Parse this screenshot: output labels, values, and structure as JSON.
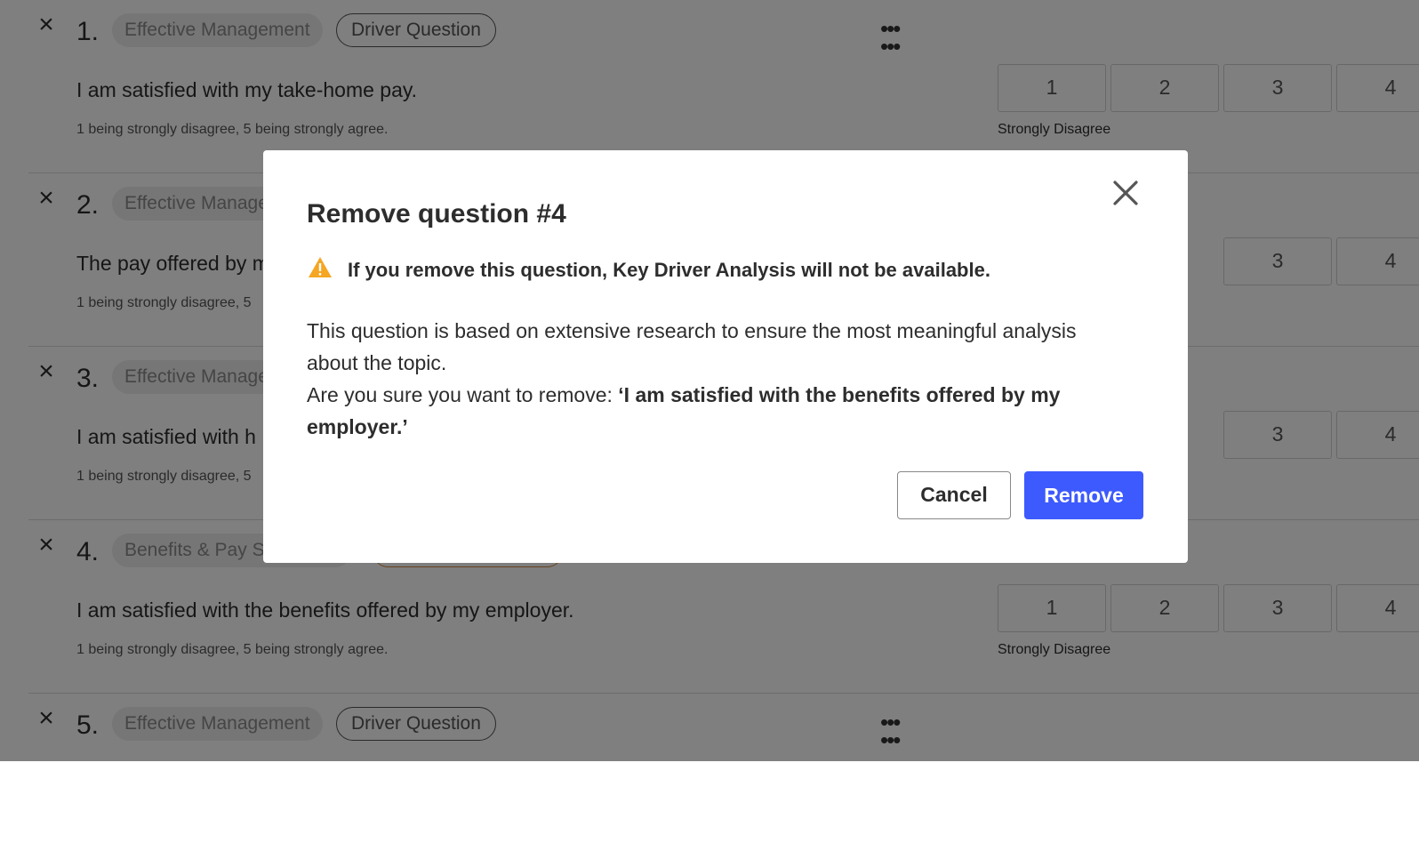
{
  "questions": [
    {
      "remove_icon": "×",
      "number": "1.",
      "topic": "Effective Management",
      "type": "Driver Question",
      "text": "I am satisfied with my take-home pay.",
      "hint": "1 being strongly disagree, 5 being strongly agree.",
      "scale": [
        "1",
        "2",
        "3",
        "4"
      ],
      "scale_label": "Strongly Disagree"
    },
    {
      "remove_icon": "×",
      "number": "2.",
      "topic": "Effective Manage",
      "text": "The pay offered by m",
      "hint": "1 being strongly disagree, 5",
      "scale": [
        "3",
        "4"
      ]
    },
    {
      "remove_icon": "×",
      "number": "3.",
      "topic": "Effective Manage",
      "text": "I am satisfied with h",
      "hint": "1 being strongly disagree, 5",
      "scale": [
        "3",
        "4"
      ]
    },
    {
      "remove_icon": "×",
      "number": "4.",
      "topic": "Benefits & Pay Sa",
      "text": "I am satisfied with the benefits offered by my employer.",
      "hint": "1 being strongly disagree, 5 being strongly agree.",
      "scale": [
        "1",
        "2",
        "3",
        "4"
      ],
      "scale_label": "Strongly Disagree"
    },
    {
      "remove_icon": "×",
      "number": "5.",
      "topic": "Effective Management",
      "type": "Driver Question"
    }
  ],
  "drag_icon": "drag-handle-icon",
  "modal": {
    "title": "Remove question #4",
    "warning_icon": "warning-icon",
    "warning_color": "#f5a623",
    "warning": "If you remove this question, Key Driver Analysis will not be available.",
    "body_line1": "This question is based on extensive research to ensure the most meaningful analysis about the topic.",
    "confirm_prefix": "Are you sure you want to remove: ",
    "confirm_question": "‘I am satisfied with the benefits offered by my employer.’",
    "cancel_label": "Cancel",
    "remove_label": "Remove",
    "accent_color": "#3d5afe"
  }
}
